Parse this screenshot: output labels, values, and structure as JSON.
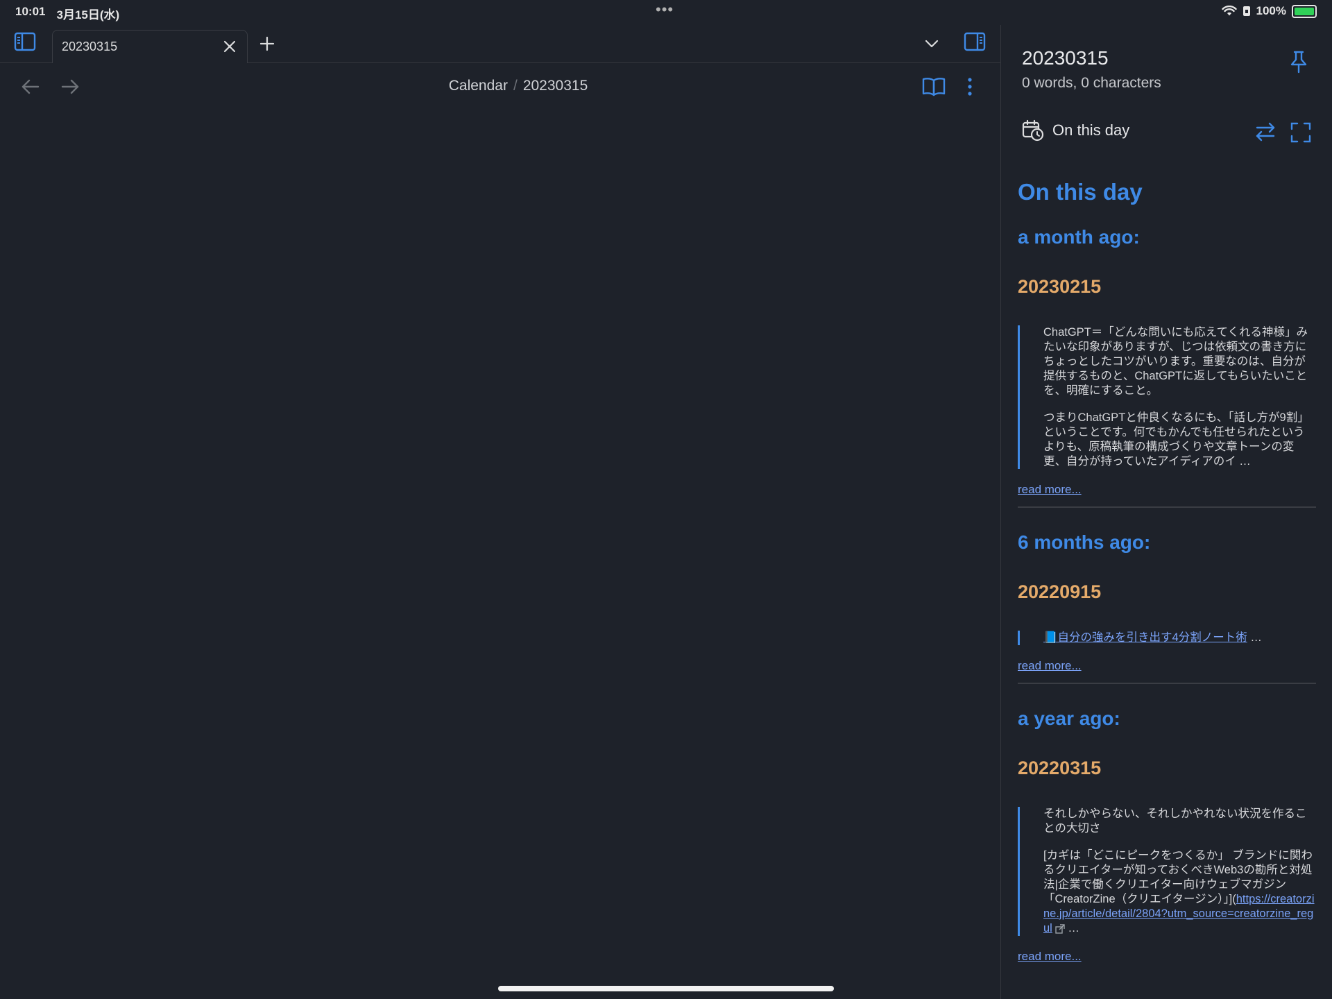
{
  "status": {
    "time": "10:01",
    "date": "3月15日(水)",
    "dots": "•••",
    "battery": "100%"
  },
  "tab": {
    "title": "20230315"
  },
  "breadcrumb": {
    "parent": "Calendar",
    "separator": "/",
    "current": "20230315"
  },
  "panel": {
    "title": "20230315",
    "subtitle": "0 words, 0 characters",
    "header_label": "On this day"
  },
  "content": {
    "heading": "On this day",
    "sections": [
      {
        "period": "a month ago:",
        "date": "20230215",
        "paragraphs": [
          "ChatGPT＝「どんな問いにも応えてくれる神様」みたいな印象がありますが、じつは依頼文の書き方にちょっとしたコツがいります。重要なのは、自分が提供するものと、ChatGPTに返してもらいたいことを、明確にすること。",
          "つまりChatGPTと仲良くなるにも、「話し方が9割」ということです。何でもかんでも任せられたというよりも、原稿執筆の構成づくりや文章トーンの変更、自分が持っていたアイディアのイ …"
        ],
        "read_more": "read more..."
      },
      {
        "period": "6 months ago:",
        "date": "20220915",
        "link_text": "📘自分の強みを引き出す4分割ノート術",
        "link_suffix": " …",
        "read_more": "read more..."
      },
      {
        "period": "a year ago:",
        "date": "20220315",
        "paragraph1": "それしかやらない、それしかやれない状況を作ることの大切さ",
        "paragraph2": "[カギは「どこにピークをつくるか」 ブランドに関わるクリエイターが知っておくべきWeb3の勘所と対処法|企業で働くクリエイター向けウェブマガジン「CreatorZine（クリエイタージン）」](",
        "url_text": "https://creatorzine.jp/article/detail/2804?utm_source=creatorzine_regul",
        "url_suffix": " …",
        "read_more": "read more..."
      }
    ]
  },
  "colors": {
    "accent": "#3f8ae6",
    "date_heading": "#e4aa6a",
    "link": "#7aa2f7",
    "background": "#1e222a"
  }
}
